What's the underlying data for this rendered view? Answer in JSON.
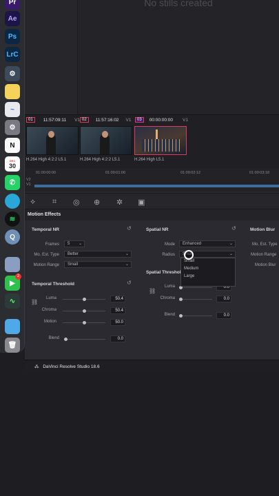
{
  "dock": {
    "apps": [
      {
        "name": "Pr",
        "color": "#3a1b6b",
        "text": "Pr"
      },
      {
        "name": "Ae",
        "color": "#2a1a6b",
        "text": "Ae"
      },
      {
        "name": "Ps",
        "color": "#0c2744",
        "text": "Ps"
      },
      {
        "name": "LrC",
        "color": "#0c2744",
        "text": "LrC"
      }
    ],
    "calendar_month": "DEC",
    "calendar_day": "30",
    "facetime_badge": "2"
  },
  "stills": {
    "empty_label": "No stills created"
  },
  "clips": [
    {
      "num": "01",
      "timecode": "11:57:09:11",
      "track": "V1",
      "caption": "H.264 High 4:2:2 L5.1"
    },
    {
      "num": "02",
      "timecode": "11:57:16:02",
      "track": "V1",
      "caption": "H.264 High 4:2:2 L5.1"
    },
    {
      "num": "03",
      "timecode": "00:00:00:00",
      "track": "V1",
      "caption": "H.264 High L5.1"
    }
  ],
  "ruler": {
    "timecodes": [
      "01:00:00:00",
      "01:00:01:06",
      "01:00:02:12",
      "01:00:03:18"
    ],
    "tracks": [
      "V2",
      "V1"
    ]
  },
  "panel": {
    "title": "Motion Effects",
    "temporal_nr": {
      "title": "Temporal NR",
      "frames_label": "Frames",
      "frames_value": "5",
      "mo_est_label": "Mo. Est. Type",
      "mo_est_value": "Better",
      "motion_range_label": "Motion Range",
      "motion_range_value": "Small"
    },
    "temporal_threshold": {
      "title": "Temporal Threshold",
      "luma_label": "Luma",
      "luma_value": "50.4",
      "chroma_label": "Chroma",
      "chroma_value": "50.4",
      "motion_label": "Motion",
      "motion_value": "50.0",
      "blend_label": "Blend",
      "blend_value": "0.0"
    },
    "spatial_nr": {
      "title": "Spatial NR",
      "mode_label": "Mode",
      "mode_value": "Enhanced",
      "radius_label": "Radius",
      "radius_value": "Small"
    },
    "radius_menu": [
      "Small",
      "Medium",
      "Large"
    ],
    "spatial_threshold": {
      "title": "Spatial Threshold",
      "luma_label": "Luma",
      "luma_value": "0.0",
      "chroma_label": "Chroma",
      "chroma_value": "0.0",
      "blend_label": "Blend",
      "blend_value": "0.0"
    },
    "motion_blur": {
      "title": "Motion Blur",
      "mo_est_label": "Mo. Est. Type",
      "motion_range_label": "Motion Range",
      "motion_blur_label": "Motion Blur"
    }
  },
  "footer": {
    "app_name": "DaVinci Resolve Studio 18.6"
  }
}
